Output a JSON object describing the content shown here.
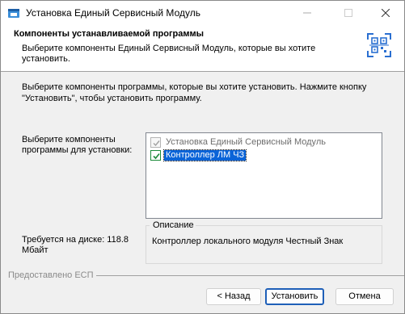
{
  "window": {
    "title": "Установка Единый Сервисный Модуль"
  },
  "header": {
    "title": "Компоненты устанавливаемой программы",
    "subtitle": "Выберите компоненты Единый Сервисный Модуль, которые вы хотите установить."
  },
  "intro": "Выберите компоненты программы, которые вы хотите установить. Нажмите кнопку \"Установить\", чтобы установить программу.",
  "components": {
    "label": "Выберите компоненты программы для установки:",
    "items": [
      {
        "label": "Установка Единый Сервисный Модуль",
        "checked": true,
        "disabled": true
      },
      {
        "label": "Контроллер ЛМ ЧЗ",
        "checked": true,
        "selected": true
      }
    ]
  },
  "description": {
    "legend": "Описание",
    "text": "Контроллер локального модуля Честный Знак"
  },
  "disk_required": "Требуется на диске: 118.8 Мбайт",
  "footer": {
    "provided_by": "Предоставлено ЕСП"
  },
  "buttons": {
    "back": "< Назад",
    "install": "Установить",
    "cancel": "Отмена"
  },
  "colors": {
    "accent": "#1e5fb8",
    "selection": "#0a64d8",
    "logo": "#2a6fd1"
  }
}
